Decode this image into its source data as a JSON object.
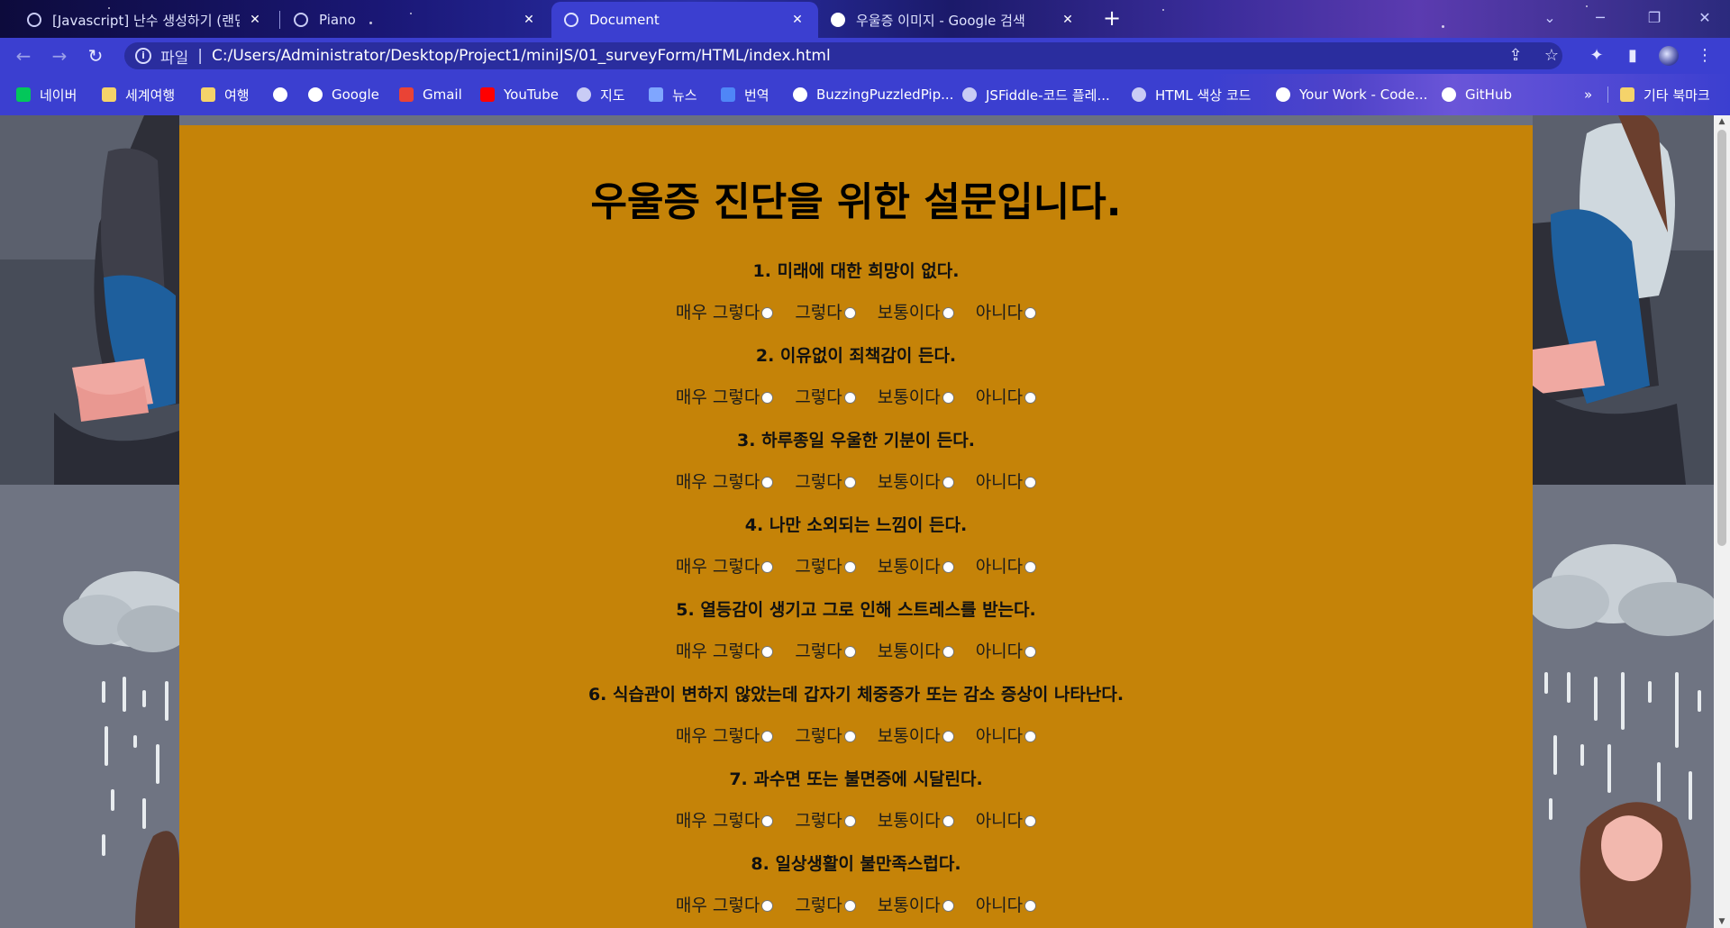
{
  "browser": {
    "tabs": [
      {
        "title": "[Javascript] 난수 생성하기 (랜덤",
        "active": false
      },
      {
        "title": "Piano",
        "active": false
      },
      {
        "title": "Document",
        "active": true
      },
      {
        "title": "우울증 이미지 - Google 검색",
        "active": false
      }
    ],
    "address": {
      "scheme_label": "파일",
      "url": "C:/Users/Administrator/Desktop/Project1/miniJS/01_surveyForm/HTML/index.html"
    },
    "bookmarks": [
      {
        "label": "네이버",
        "icon": "naver-icon",
        "color": "#03c75a"
      },
      {
        "label": "세계여행",
        "icon": "folder-icon",
        "color": "#f5d36a"
      },
      {
        "label": "여행",
        "icon": "folder-icon",
        "color": "#f5d36a"
      },
      {
        "label": "",
        "icon": "google-icon",
        "color": "#ffffff"
      },
      {
        "label": "Google",
        "icon": "google-icon",
        "color": "#ffffff"
      },
      {
        "label": "Gmail",
        "icon": "gmail-icon",
        "color": "#ea4335"
      },
      {
        "label": "YouTube",
        "icon": "youtube-icon",
        "color": "#ff0000"
      },
      {
        "label": "지도",
        "icon": "globe-icon",
        "color": "#c9ccf5"
      },
      {
        "label": "뉴스",
        "icon": "news-icon",
        "color": "#7fa6ff"
      },
      {
        "label": "번역",
        "icon": "translate-icon",
        "color": "#4f86f7"
      },
      {
        "label": "BuzzingPuzzledPip...",
        "icon": "replit-icon",
        "color": "#ffffff"
      },
      {
        "label": "JSFiddle-코드 플레...",
        "icon": "globe-icon",
        "color": "#c9ccf5"
      },
      {
        "label": "HTML 색상 코드",
        "icon": "globe-icon",
        "color": "#c9ccf5"
      },
      {
        "label": "Your Work - Code...",
        "icon": "codepen-icon",
        "color": "#ffffff"
      },
      {
        "label": "GitHub",
        "icon": "github-icon",
        "color": "#ffffff"
      }
    ],
    "bookmarks_overflow": "»",
    "other_bookmarks": "기타 북마크"
  },
  "page": {
    "title": "우울증 진단을 위한 설문입니다.",
    "options": [
      "매우 그렇다",
      "그렇다",
      "보통이다",
      "아니다"
    ],
    "questions": [
      "1. 미래에 대한 희망이 없다.",
      "2. 이유없이 죄책감이 든다.",
      "3. 하루종일 우울한 기분이 든다.",
      "4. 나만 소외되는 느낌이 든다.",
      "5. 열등감이 생기고 그로 인해 스트레스를 받는다.",
      "6. 식습관이 변하지 않았는데 갑자기 체중증가 또는 감소 증상이 나타난다.",
      "7. 과수면 또는 불면증에 시달린다.",
      "8. 일상생활이 불만족스럽다."
    ]
  },
  "colors": {
    "panel": "#c58308",
    "toolbar": "#3b3fd0"
  }
}
